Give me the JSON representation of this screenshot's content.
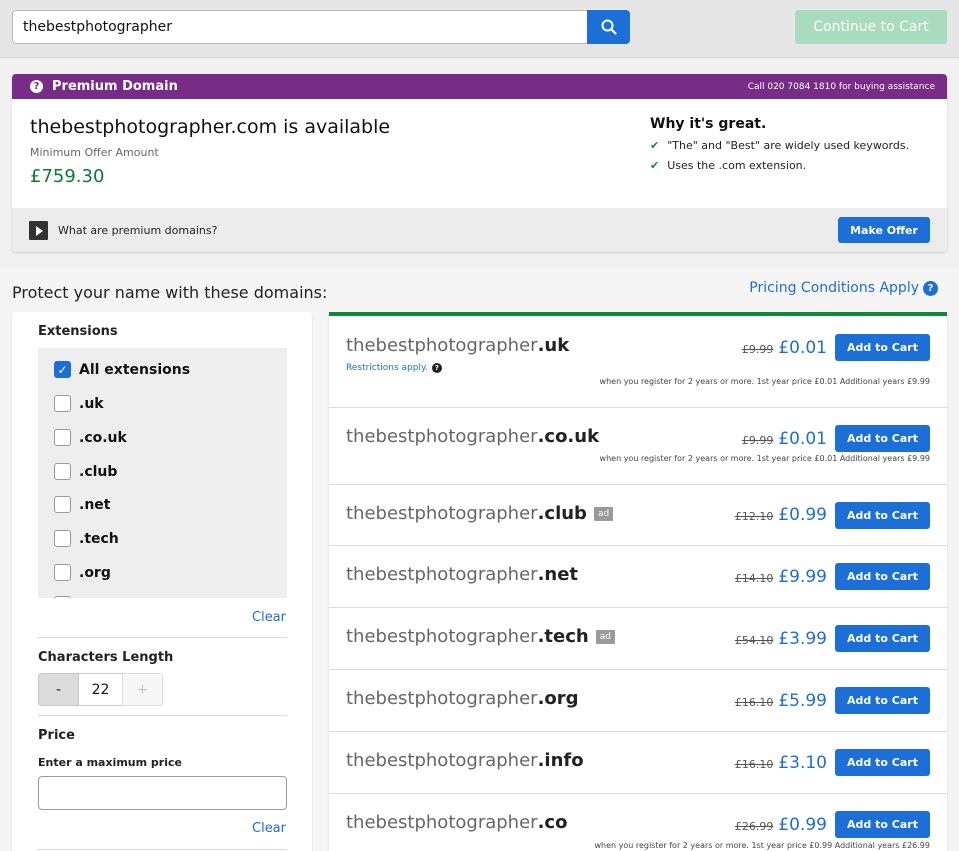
{
  "search": {
    "value": "thebestphotographer",
    "continue_label": "Continue to Cart"
  },
  "premium": {
    "banner_title": "Premium Domain",
    "call_text": "Call 020 7084 1810 for buying assistance",
    "domain_status": "thebestphotographer.com is available",
    "min_offer_label": "Minimum Offer Amount",
    "price": "£759.30",
    "why_title": "Why it's great.",
    "why_items": [
      "\"The\" and \"Best\" are widely used keywords.",
      "Uses the .com extension."
    ],
    "what_are_label": "What are premium domains?",
    "make_offer_label": "Make Offer"
  },
  "protect": {
    "title": "Protect your name with these domains:",
    "pricing_link": "Pricing Conditions Apply"
  },
  "filters": {
    "extensions_heading": "Extensions",
    "extensions": [
      {
        "label": "All extensions",
        "checked": true
      },
      {
        "label": ".uk",
        "checked": false
      },
      {
        "label": ".co.uk",
        "checked": false
      },
      {
        "label": ".club",
        "checked": false
      },
      {
        "label": ".net",
        "checked": false
      },
      {
        "label": ".tech",
        "checked": false
      },
      {
        "label": ".org",
        "checked": false
      }
    ],
    "clear_label": "Clear",
    "length_heading": "Characters Length",
    "length_minus": "-",
    "length_value": "22",
    "length_plus": "+",
    "price_heading": "Price",
    "max_price_label": "Enter a maximum price",
    "max_price_value": "",
    "price_clear_label": "Clear"
  },
  "results": [
    {
      "name": "thebestphotographer",
      "tld": ".uk",
      "ad": false,
      "old_price": "£9.99",
      "new_price": "£0.01",
      "restriction": "Restrictions apply.",
      "note": "when you register for 2 years or more. 1st year price £0.01 Additional years £9.99"
    },
    {
      "name": "thebestphotographer",
      "tld": ".co.uk",
      "ad": false,
      "old_price": "£9.99",
      "new_price": "£0.01",
      "restriction": "",
      "note": "when you register for 2 years or more. 1st year price £0.01 Additional years £9.99"
    },
    {
      "name": "thebestphotographer",
      "tld": ".club",
      "ad": true,
      "old_price": "£12.10",
      "new_price": "£0.99",
      "restriction": "",
      "note": ""
    },
    {
      "name": "thebestphotographer",
      "tld": ".net",
      "ad": false,
      "old_price": "£14.10",
      "new_price": "£9.99",
      "restriction": "",
      "note": ""
    },
    {
      "name": "thebestphotographer",
      "tld": ".tech",
      "ad": true,
      "old_price": "£54.10",
      "new_price": "£3.99",
      "restriction": "",
      "note": ""
    },
    {
      "name": "thebestphotographer",
      "tld": ".org",
      "ad": false,
      "old_price": "£16.10",
      "new_price": "£5.99",
      "restriction": "",
      "note": ""
    },
    {
      "name": "thebestphotographer",
      "tld": ".info",
      "ad": false,
      "old_price": "£16.10",
      "new_price": "£3.10",
      "restriction": "",
      "note": ""
    },
    {
      "name": "thebestphotographer",
      "tld": ".co",
      "ad": false,
      "old_price": "£26.99",
      "new_price": "£0.99",
      "restriction": "",
      "note": "when you register for 2 years or more. 1st year price £0.99 Additional years £26.99"
    }
  ],
  "labels": {
    "add_to_cart": "Add to Cart",
    "ad_badge": "ad"
  },
  "colors": {
    "brand_blue": "#1b6fd6",
    "premium_purple": "#772d85",
    "success_green": "#0c8a3a",
    "continue_disabled": "#a8dcbc"
  }
}
